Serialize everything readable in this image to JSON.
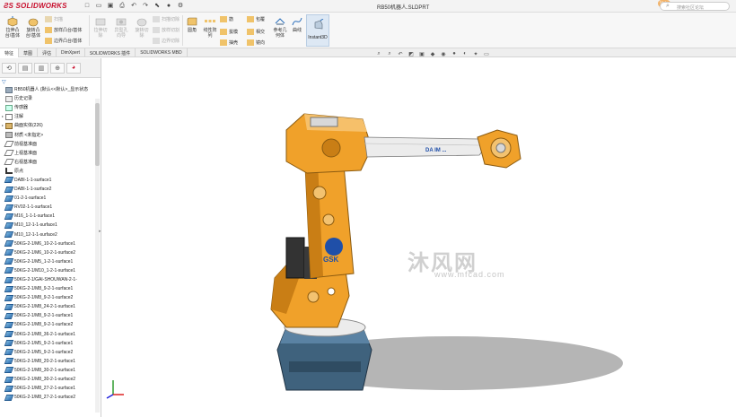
{
  "app": {
    "brand": "SOLIDWORKS",
    "document_title": "RB50机器人.SLDPRT",
    "search_placeholder": "搜索社区论坛",
    "notification_badge": "Vote"
  },
  "quick_access": [
    "new-icon",
    "open-icon",
    "save-icon",
    "print-icon",
    "undo-icon",
    "redo-icon",
    "select-icon",
    "rebuild-icon",
    "options-icon"
  ],
  "ribbon": {
    "extrude_boss": "拉伸凸\n台/基体",
    "revolve_boss": "旋转凸\n台/基体",
    "sweep_boss": "扫描",
    "loft_boss": "放样凸台/基体",
    "boundary_boss": "边界凸台/基体",
    "extrude_cut": "拉伸切\n除",
    "hole_wizard": "异型孔\n向导",
    "revolve_cut": "旋转切\n除",
    "swept_cut": "扫描切除",
    "lofted_cut": "放样切割",
    "boundary_cut": "边界切除",
    "fillet": "圆角",
    "linear_pattern": "线性阵\n列",
    "rib": "筋",
    "wrap": "包覆",
    "draft": "拔模",
    "intersect": "相交",
    "shell": "抽壳",
    "mirror": "镜向",
    "reference_geometry": "参考几\n何体",
    "curves": "曲线",
    "instant3d": "Instant3D"
  },
  "tabs": [
    "特征",
    "草图",
    "评估",
    "DimXpert",
    "SOLIDWORKS 插件",
    "SOLIDWORKS MBD"
  ],
  "panel": {
    "tabs": [
      "feature-manager-icon",
      "property-manager-icon",
      "configuration-manager-icon",
      "dimxpert-icon",
      "display-manager-icon"
    ],
    "filter_icon": "filter-icon",
    "tree": [
      {
        "label": "RB50机器人 (默认<<默认>_显示状态",
        "icon": "doc",
        "exp": ""
      },
      {
        "label": "历史记录",
        "icon": "hist",
        "exp": ""
      },
      {
        "label": "传感器",
        "icon": "sensor",
        "exp": ""
      },
      {
        "label": "注解",
        "icon": "note",
        "exp": "▸"
      },
      {
        "label": "曲面实体(226)",
        "icon": "body",
        "exp": "▸"
      },
      {
        "label": "材质 <未指定>",
        "icon": "mat",
        "exp": ""
      },
      {
        "label": "前视基准面",
        "icon": "plane",
        "exp": ""
      },
      {
        "label": "上视基准面",
        "icon": "plane",
        "exp": ""
      },
      {
        "label": "右视基准面",
        "icon": "plane",
        "exp": ""
      },
      {
        "label": "原点",
        "icon": "origin",
        "exp": ""
      },
      {
        "label": "DABI-1-1-surface1",
        "icon": "surf",
        "exp": ""
      },
      {
        "label": "DABI-1-1-surface2",
        "icon": "surf",
        "exp": ""
      },
      {
        "label": "01-2-1-surface1",
        "icon": "surf",
        "exp": ""
      },
      {
        "label": "RV02-1-1-surface1",
        "icon": "surf",
        "exp": ""
      },
      {
        "label": "M16_1-1-1-surface1",
        "icon": "surf",
        "exp": ""
      },
      {
        "label": "M10_12-1-1-surface1",
        "icon": "surf",
        "exp": ""
      },
      {
        "label": "M10_12-1-1-surface2",
        "icon": "surf",
        "exp": ""
      },
      {
        "label": "50KG-2-1/M6_10-2-1-surface1",
        "icon": "surf",
        "exp": ""
      },
      {
        "label": "50KG-2-1/M6_10-2-1-surface2",
        "icon": "surf",
        "exp": ""
      },
      {
        "label": "50KG-2-1/M5_1-2-1-surface1",
        "icon": "surf",
        "exp": ""
      },
      {
        "label": "50KG-2-1/M10_1-2-1-surface1",
        "icon": "surf",
        "exp": ""
      },
      {
        "label": "50KG-2-1/GAI-SHOUWAN-2-1-",
        "icon": "surf",
        "exp": ""
      },
      {
        "label": "50KG-2-1/M8_9-2-1-surface1",
        "icon": "surf",
        "exp": ""
      },
      {
        "label": "50KG-2-1/M8_9-2-1-surface2",
        "icon": "surf",
        "exp": ""
      },
      {
        "label": "50KG-2-1/M8_24-2-1-surface1",
        "icon": "surf",
        "exp": ""
      },
      {
        "label": "50KG-2-1/M8_9-2-1-surface1",
        "icon": "surf",
        "exp": ""
      },
      {
        "label": "50KG-2-1/M8_9-2-1-surface2",
        "icon": "surf",
        "exp": ""
      },
      {
        "label": "50KG-2-1/M8_36-2-1-surface1",
        "icon": "surf",
        "exp": ""
      },
      {
        "label": "50KG-2-1/M5_9-2-1-surface1",
        "icon": "surf",
        "exp": ""
      },
      {
        "label": "50KG-2-1/M5_9-2-1-surface2",
        "icon": "surf",
        "exp": ""
      },
      {
        "label": "50KG-2-1/M8_20-2-1-surface1",
        "icon": "surf",
        "exp": ""
      },
      {
        "label": "50KG-2-1/M8_30-2-1-surface1",
        "icon": "surf",
        "exp": ""
      },
      {
        "label": "50KG-2-1/M8_30-2-1-surface2",
        "icon": "surf",
        "exp": ""
      },
      {
        "label": "50KG-2-1/M8_27-2-1-surface1",
        "icon": "surf",
        "exp": ""
      },
      {
        "label": "50KG-2-1/M8_27-2-1-surface2",
        "icon": "surf",
        "exp": ""
      }
    ]
  },
  "view_toolbar": [
    "zoom-to-fit-icon",
    "zoom-area-icon",
    "previous-view-icon",
    "section-view-icon",
    "view-orientation-icon",
    "display-style-icon",
    "hide-show-icon",
    "edit-appearance-icon",
    "apply-scene-icon",
    "view-settings-icon",
    "monitor-icon"
  ],
  "viewport": {
    "watermark": "沐风网",
    "watermark_url": "www.mfcad.com",
    "robot_logo": "GSK",
    "arm_text": "DA IM ...",
    "colors": {
      "robot_orange": "#f0a12a",
      "robot_dark": "#4a4a4a",
      "base_blue": "#4a6f8c"
    }
  }
}
